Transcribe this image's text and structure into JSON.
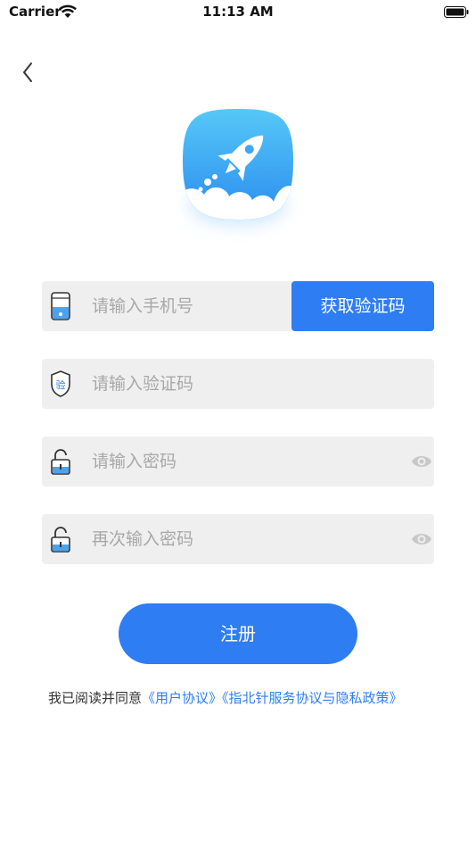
{
  "status_bar": {
    "carrier": "Carrier",
    "time": "11:13 AM"
  },
  "form": {
    "phone_placeholder": "请输入手机号",
    "get_code_label": "获取验证码",
    "code_placeholder": "请输入验证码",
    "password_placeholder": "请输入密码",
    "confirm_password_placeholder": "再次输入密码"
  },
  "register_label": "注册",
  "agreement": {
    "prefix": "我已阅读并同意",
    "user_agreement": "《用户协议》",
    "service_privacy": "《指北针服务协议与隐私政策》"
  },
  "colors": {
    "accent": "#2f7df2",
    "field_bg": "#efefef",
    "placeholder": "#a8a8a8"
  }
}
